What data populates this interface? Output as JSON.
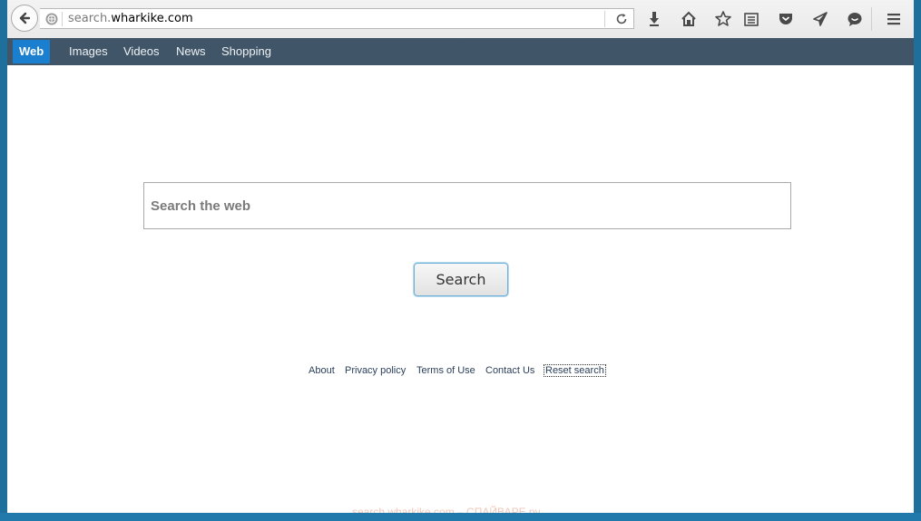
{
  "browser": {
    "url_prefix": "search.",
    "url_host": "wharkike.com",
    "toolbar_icons": [
      "download-icon",
      "home-icon",
      "bookmark-star-icon",
      "reading-list-icon",
      "pocket-icon",
      "share-icon",
      "chat-icon",
      "menu-icon"
    ]
  },
  "nav": {
    "items": [
      {
        "label": "Web",
        "active": true
      },
      {
        "label": "Images",
        "active": false
      },
      {
        "label": "Videos",
        "active": false
      },
      {
        "label": "News",
        "active": false
      },
      {
        "label": "Shopping",
        "active": false
      }
    ]
  },
  "search": {
    "placeholder": "Search the web",
    "value": "",
    "button_label": "Search"
  },
  "footer": {
    "links": [
      "About",
      "Privacy policy",
      "Terms of Use",
      "Contact Us",
      "Reset search"
    ]
  },
  "watermark": "search.wharkike.com – СПАЙВАРЕ.ру",
  "colors": {
    "nav_bg": "#405567",
    "nav_active": "#1b7fd0",
    "desktop": "#1f6f9d"
  }
}
